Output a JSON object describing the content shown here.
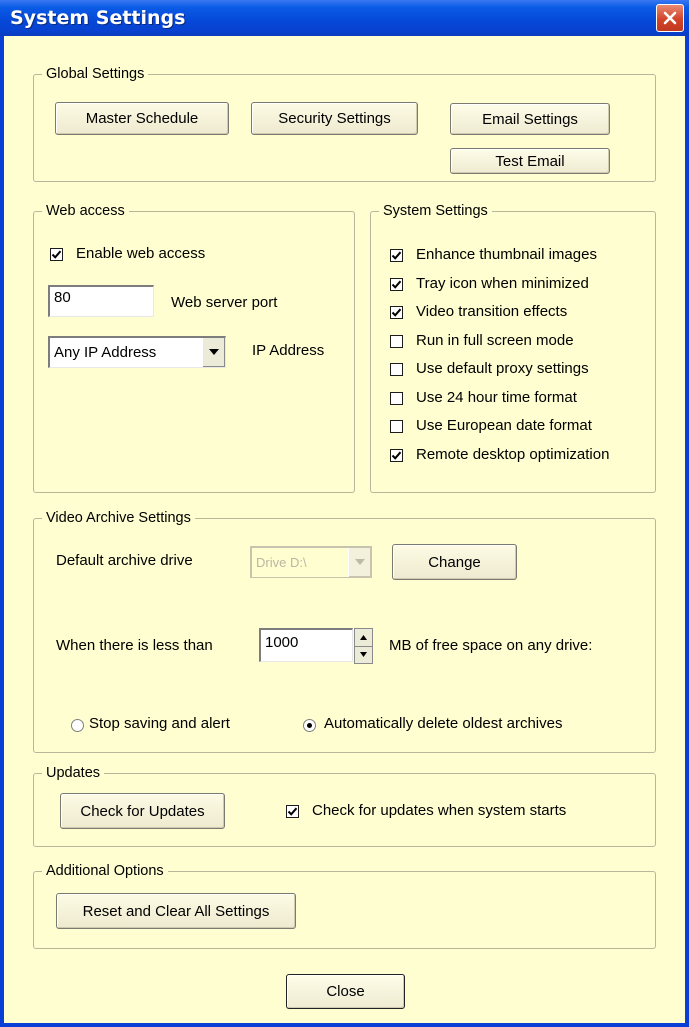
{
  "window": {
    "title": "System Settings"
  },
  "global_settings": {
    "legend": "Global Settings",
    "master_schedule": "Master Schedule",
    "security_settings": "Security Settings",
    "email_settings": "Email Settings",
    "test_email": "Test Email"
  },
  "web_access": {
    "legend": "Web access",
    "enable_label": "Enable web access",
    "enable_checked": true,
    "port_value": "80",
    "port_label": "Web server port",
    "ip_selected": "Any IP Address",
    "ip_label": "IP Address"
  },
  "system_settings": {
    "legend": "System Settings",
    "options": [
      {
        "label": "Enhance thumbnail images",
        "checked": true
      },
      {
        "label": "Tray icon when minimized",
        "checked": true
      },
      {
        "label": "Video transition effects",
        "checked": true
      },
      {
        "label": "Run in full screen mode",
        "checked": false
      },
      {
        "label": "Use default proxy settings",
        "checked": false
      },
      {
        "label": "Use 24 hour time format",
        "checked": false
      },
      {
        "label": "Use European date format",
        "checked": false
      },
      {
        "label": "Remote desktop optimization",
        "checked": true
      }
    ]
  },
  "video_archive": {
    "legend": "Video Archive Settings",
    "drive_label": "Default archive drive",
    "drive_selected": "Drive D:\\",
    "change_label": "Change",
    "less_than_label": "When there is less than",
    "threshold_value": "1000",
    "free_space_label": "MB of free space on any drive:",
    "stop_saving_label": "Stop saving and alert",
    "auto_delete_label": "Automatically delete oldest archives",
    "selected_option": "auto_delete"
  },
  "updates": {
    "legend": "Updates",
    "check_button": "Check for Updates",
    "auto_check_label": "Check for updates when system starts",
    "auto_check_checked": true
  },
  "additional": {
    "legend": "Additional Options",
    "reset_button": "Reset and Clear All Settings"
  },
  "footer": {
    "close_button": "Close"
  },
  "colors": {
    "dialog_bg": "#fffed0",
    "title_bar": "#0647d8",
    "close_button": "#d2452a"
  }
}
